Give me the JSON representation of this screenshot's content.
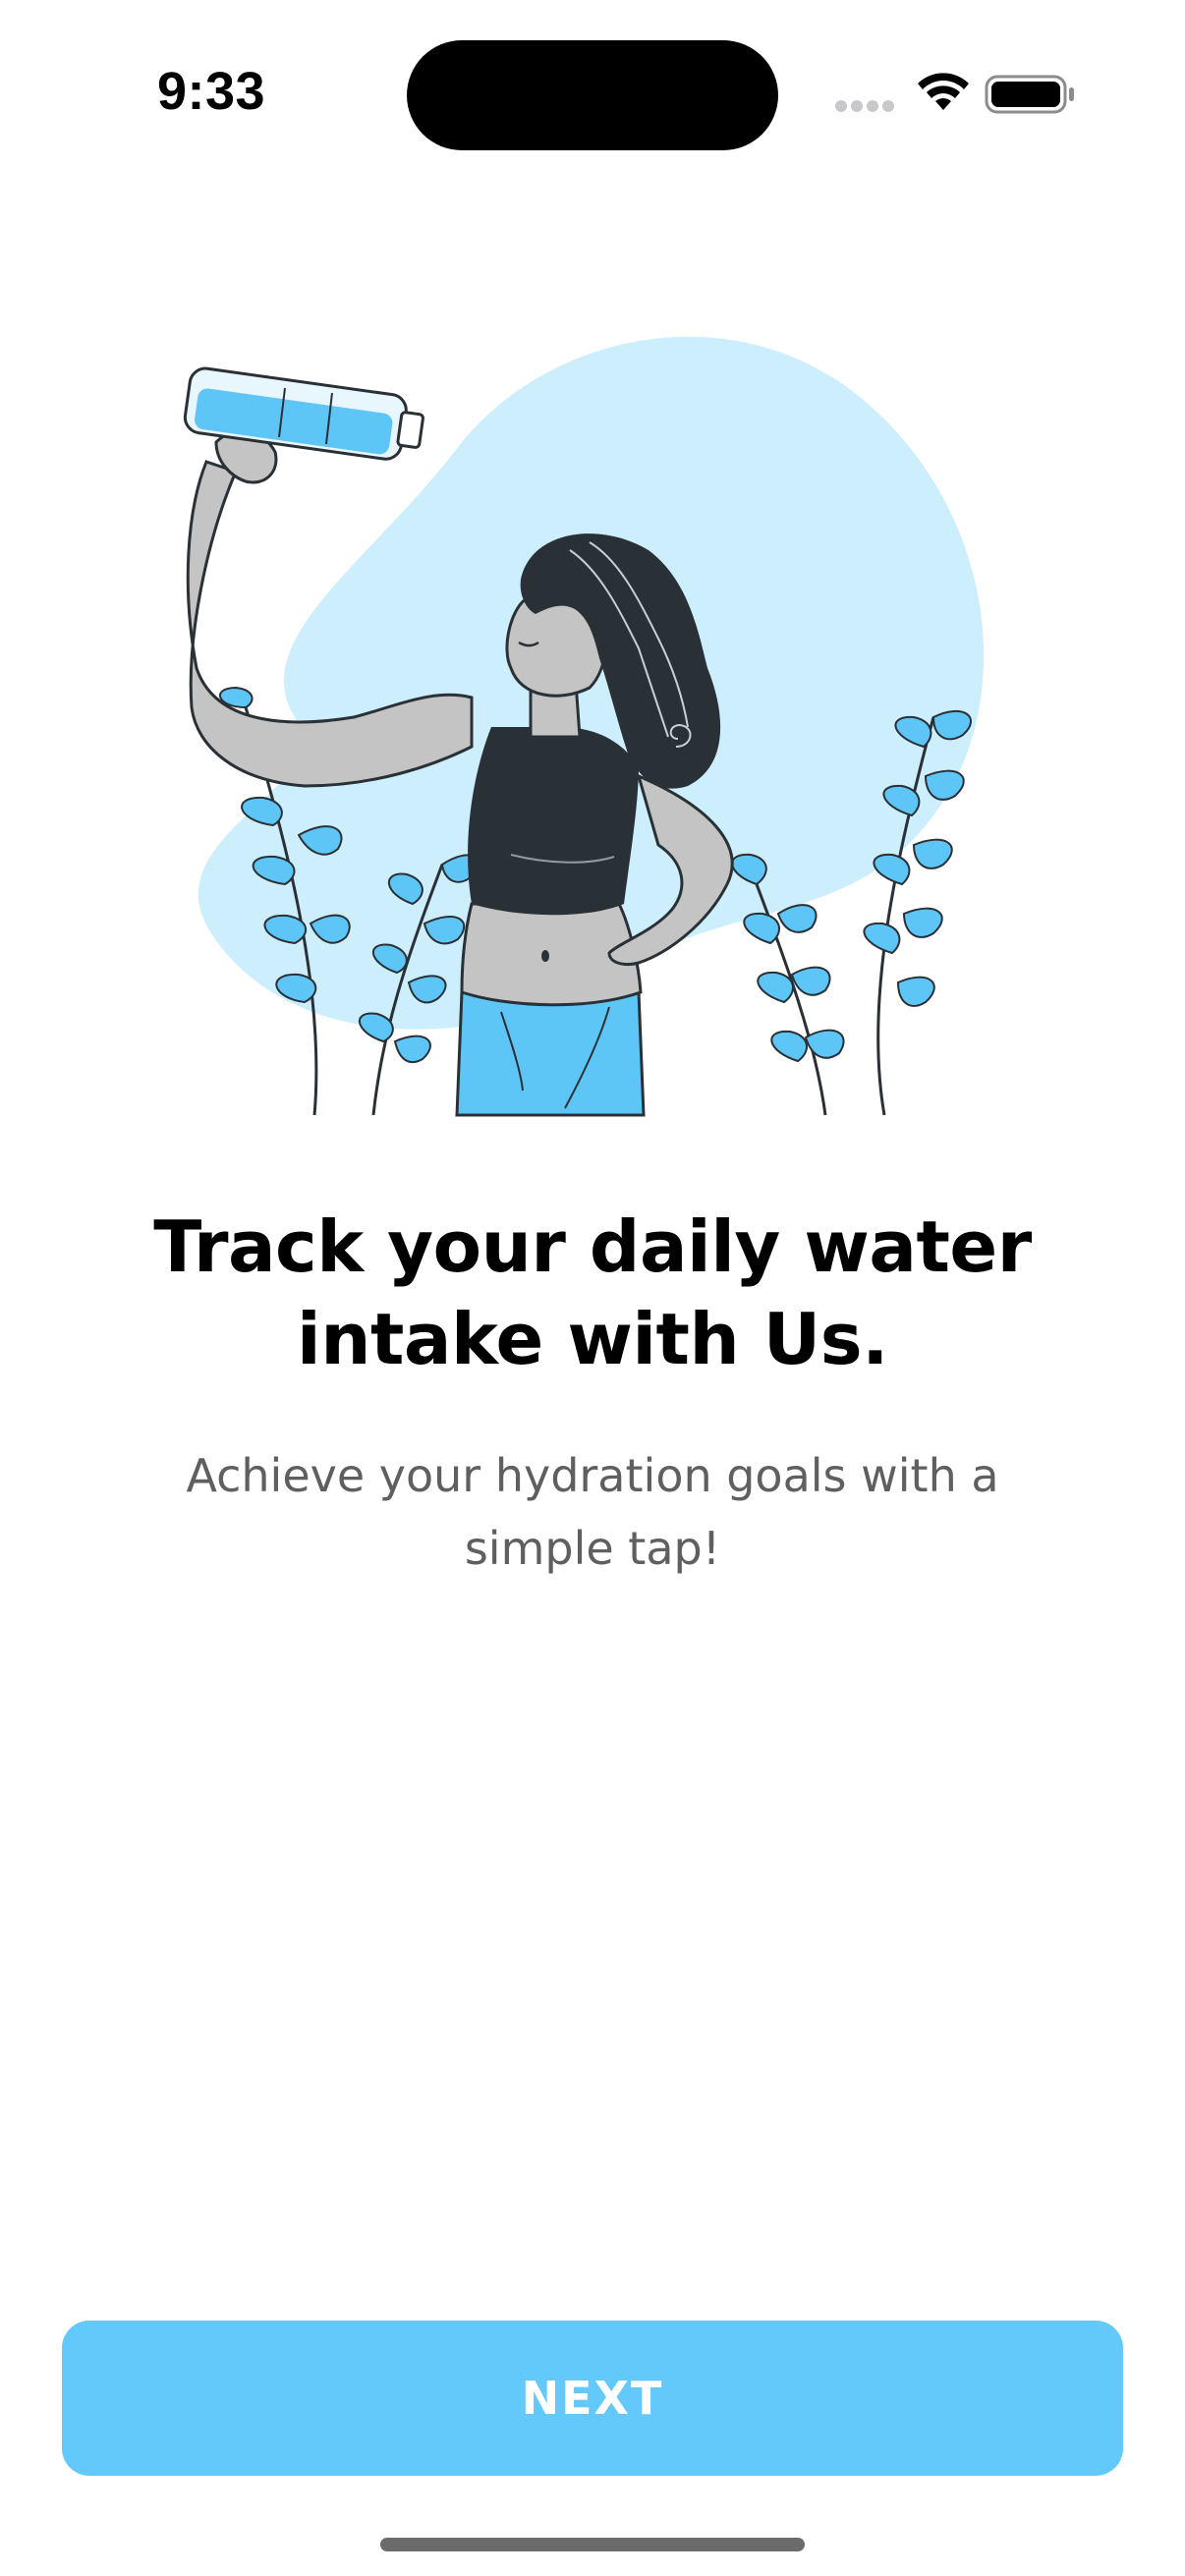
{
  "status_bar": {
    "time": "9:33"
  },
  "onboarding": {
    "title": "Track your daily water intake with Us.",
    "subtitle": "Achieve your hydration goals with a simple tap!",
    "next_label": "NEXT"
  },
  "colors": {
    "accent": "#63c9fa",
    "blob": "#cdeefd",
    "dark": "#2a3136",
    "skin": "#c4c4c4"
  },
  "icons": {
    "wifi": "wifi-icon",
    "battery": "battery-icon",
    "signal": "signal-dots-icon"
  }
}
